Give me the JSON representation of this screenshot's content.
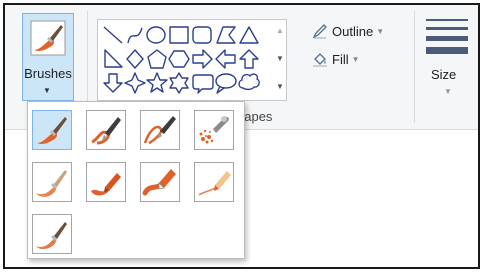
{
  "toolbar": {
    "brushes_label": "Brushes",
    "shapes_group_label": "hapes",
    "outline_label": "Outline",
    "fill_label": "Fill",
    "size_label": "Size"
  },
  "shapes": [
    "line-shape",
    "curve-shape",
    "oval-shape",
    "rectangle-shape",
    "rounded-rectangle-shape",
    "polygon-shape",
    "triangle-shape",
    "right-triangle-shape",
    "diamond-shape",
    "pentagon-shape",
    "hexagon-shape",
    "right-arrow-shape",
    "left-arrow-shape",
    "up-arrow-shape",
    "down-arrow-shape",
    "four-point-star-shape",
    "five-point-star-shape",
    "six-point-star-shape",
    "rounded-callout-shape",
    "oval-callout-shape",
    "cloud-callout-shape"
  ],
  "brushes": [
    {
      "name": "brush",
      "selected": true
    },
    {
      "name": "calligraphy-brush-1",
      "selected": false
    },
    {
      "name": "calligraphy-brush-2",
      "selected": false
    },
    {
      "name": "airbrush",
      "selected": false
    },
    {
      "name": "oil-brush",
      "selected": false
    },
    {
      "name": "crayon",
      "selected": false
    },
    {
      "name": "marker",
      "selected": false
    },
    {
      "name": "natural-pencil",
      "selected": false
    },
    {
      "name": "watercolor-brush",
      "selected": false
    }
  ],
  "colors": {
    "accent": "#cde6f7",
    "accent_border": "#7eb4ea",
    "paint": "#e0622b",
    "size_lines": "#4a5c78"
  }
}
